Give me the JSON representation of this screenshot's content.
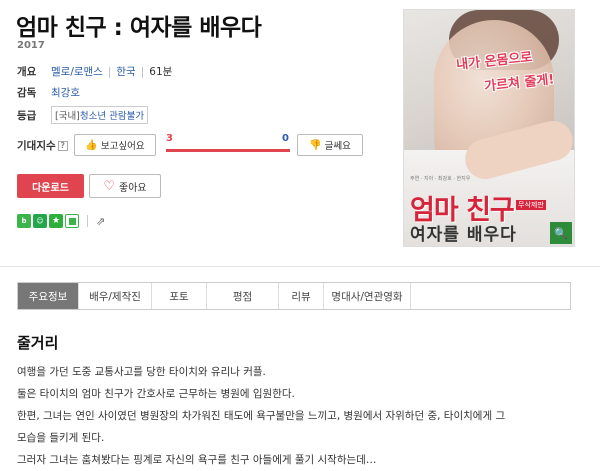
{
  "movie": {
    "title": "엄마 친구 : 여자를 배우다",
    "year": "2017"
  },
  "info": {
    "overview_label": "개요",
    "genre": "멜로/로맨스",
    "country": "한국",
    "runtime": "61분",
    "director_label": "감독",
    "director": "최강호",
    "rating_label": "등급",
    "rating_tag": "[국내]",
    "rating": "청소년 관람불가"
  },
  "expectation": {
    "label": "기대지수",
    "help_icon": "question-mark-icon",
    "want_label": "보고싶어요",
    "meh_label": "글쎄요",
    "want_score": 3,
    "meh_score": 0,
    "want_fraction": 1.0
  },
  "actions": {
    "download_label": "다운로드",
    "like_label": "좋아요"
  },
  "poster": {
    "tagline_1": "내가 온몸으로",
    "tagline_2": "가르쳐 줄게!",
    "credits": "주연 · 지아 · 최강호 · 한지우",
    "title_line1": "엄마 친구",
    "badge": "무삭제판",
    "title_line2": "여자를 배우다"
  },
  "tabs": [
    {
      "label": "주요정보",
      "active": true
    },
    {
      "label": "배우/제작진",
      "active": false
    },
    {
      "label": "포토",
      "active": false
    },
    {
      "label": "평점",
      "active": false
    },
    {
      "label": "리뷰",
      "active": false
    },
    {
      "label": "명대사/연관영화",
      "active": false
    },
    {
      "label": "",
      "active": false
    }
  ],
  "synopsis": {
    "title": "줄거리",
    "lines": [
      "여행을 가던 도중 교통사고를 당한 타이치와 유리나 커플.",
      "  둘은 타이치의 엄마 친구가 간호사로 근무하는 병원에 입원한다.",
      "  한편, 그녀는 연인 사이였던 병원장의 차가워진 태도에 욕구불만을 느끼고, 병원에서 자위하던 중, 타이치에게 그",
      "모습을 들키게 된다.",
      "  그러자 그녀는 훔쳐봤다는 핑계로 자신의 욕구를 친구 아들에게 풀기 시작하는데…"
    ]
  },
  "colors": {
    "accent": "#e0454f",
    "link": "#2a5caa",
    "share_green": "#3bb54a"
  }
}
